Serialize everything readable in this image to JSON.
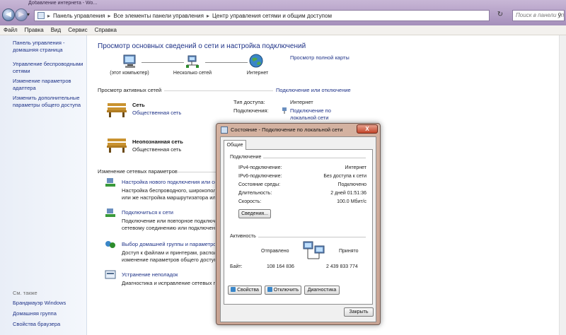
{
  "window": {
    "tab_title": "Добавление интернета - Wo...",
    "breadcrumbs": [
      "Панель управления",
      "Все элементы панели управления",
      "Центр управления сетями и общим доступом"
    ],
    "search_placeholder": "Поиск в панели уп..."
  },
  "menu": [
    "Файл",
    "Правка",
    "Вид",
    "Сервис",
    "Справка"
  ],
  "sidebar": {
    "home": "Панель управления - домашняя страница",
    "items": [
      "Управление беспроводными сетями",
      "Изменение параметров адаптера",
      "Изменить дополнительные параметры общего доступа"
    ],
    "see_also_title": "См. также",
    "see_also": [
      "Брандмауэр Windows",
      "Домашняя группа",
      "Свойства браузера"
    ]
  },
  "main": {
    "title": "Просмотр основных сведений о сети и настройка подключений",
    "map_link": "Просмотр полной карты",
    "map_labels": [
      "(этот компьютер)",
      "Несколько сетей",
      "Интернет"
    ],
    "active_title": "Просмотр активных сетей",
    "connect_link": "Подключение или отключение",
    "networks": [
      {
        "name": "Сеть",
        "type": "Общественная сеть",
        "access_key": "Тип доступа:",
        "access_val": "Интернет",
        "conn_key": "Подключения:",
        "conn_val": "Подключение по локальной сети"
      },
      {
        "name": "Неопознанная сеть",
        "type": "Общественная сеть"
      }
    ],
    "change_title": "Изменение сетевых параметров",
    "tasks": [
      {
        "link": "Настройка нового подключения или сети",
        "desc1": "Настройка беспроводного, широкополосного,",
        "desc2": "или же настройка маршрутизатора или точки"
      },
      {
        "link": "Подключиться к сети",
        "desc1": "Подключение или повторное подключение к",
        "desc2": "сетевому соединению или подключению"
      },
      {
        "link": "Выбор домашней группы и параметров",
        "desc1": "Доступ к файлам и принтерам, располо",
        "desc2": "изменение параметров общего доступа"
      },
      {
        "link": "Устранение неполадок",
        "desc1": "Диагностика и исправление сетевых проб",
        "desc2": ""
      }
    ]
  },
  "dialog": {
    "title": "Состояние - Подключение по локальной сети",
    "close": "X",
    "tab": "Общие",
    "connection_group": "Подключение",
    "rows": [
      {
        "k": "IPv4-подключение:",
        "v": "Интернет"
      },
      {
        "k": "IPv6-подключение:",
        "v": "Без доступа к сети"
      },
      {
        "k": "Состояние среды:",
        "v": "Подключено"
      },
      {
        "k": "Длительность:",
        "v": "2 дней 01:51:36"
      },
      {
        "k": "Скорость:",
        "v": "100.0 Мбит/с"
      }
    ],
    "details_button": "Сведения...",
    "activity_group": "Активность",
    "sent_label": "Отправлено",
    "received_label": "Принято",
    "bytes_label": "Байт:",
    "bytes_sent": "108 164 836",
    "bytes_received": "2 439 833 774",
    "properties_button": "Свойства",
    "disable_button": "Отключить",
    "diagnose_button": "Диагностика",
    "close_button": "Закрыть"
  }
}
